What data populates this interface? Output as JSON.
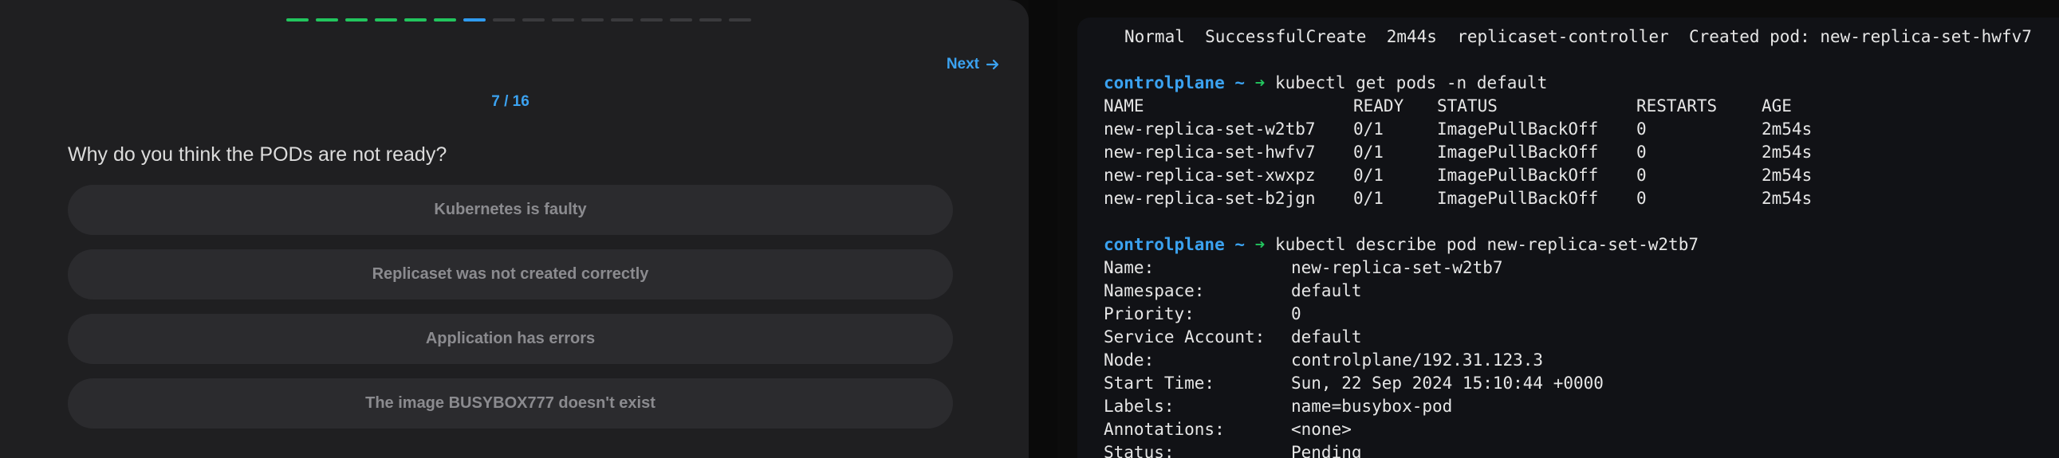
{
  "quiz": {
    "progress_total": 16,
    "progress_done": 6,
    "progress_current_index": 6,
    "next_label": "Next",
    "counter": "7 / 16",
    "question": "Why do you think the PODs are not ready?",
    "options": [
      "Kubernetes is faulty",
      "Replicaset was not created correctly",
      "Application has errors",
      "The image BUSYBOX777 doesn't exist"
    ]
  },
  "terminal": {
    "event_line": "Normal  SuccessfulCreate  2m44s  replicaset-controller  Created pod: new-replica-set-hwfv7",
    "prompt_host": "controlplane",
    "prompt_sep": " ~ ",
    "prompt_arrow": "➜",
    "cmd1": "kubectl get pods -n default",
    "pods_header": [
      "NAME",
      "READY",
      "STATUS",
      "RESTARTS",
      "AGE"
    ],
    "pods": [
      [
        "new-replica-set-w2tb7",
        "0/1",
        "ImagePullBackOff",
        "0",
        "2m54s"
      ],
      [
        "new-replica-set-hwfv7",
        "0/1",
        "ImagePullBackOff",
        "0",
        "2m54s"
      ],
      [
        "new-replica-set-xwxpz",
        "0/1",
        "ImagePullBackOff",
        "0",
        "2m54s"
      ],
      [
        "new-replica-set-b2jgn",
        "0/1",
        "ImagePullBackOff",
        "0",
        "2m54s"
      ]
    ],
    "cmd2": "kubectl describe pod new-replica-set-w2tb7",
    "describe": [
      [
        "Name:",
        "new-replica-set-w2tb7"
      ],
      [
        "Namespace:",
        "default"
      ],
      [
        "Priority:",
        "0"
      ],
      [
        "Service Account:",
        "default"
      ],
      [
        "Node:",
        "controlplane/192.31.123.3"
      ],
      [
        "Start Time:",
        "Sun, 22 Sep 2024 15:10:44 +0000"
      ],
      [
        "Labels:",
        "name=busybox-pod"
      ],
      [
        "Annotations:",
        "<none>"
      ],
      [
        "Status:",
        "Pending"
      ]
    ]
  }
}
